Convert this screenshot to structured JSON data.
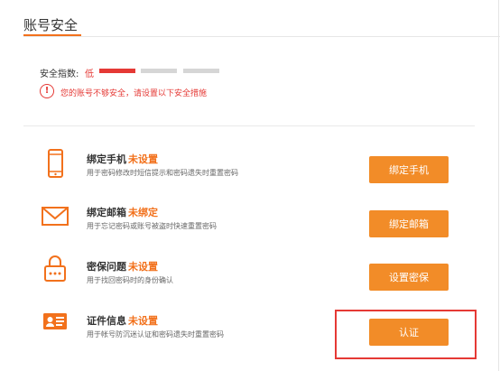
{
  "page": {
    "title": "账号安全"
  },
  "security": {
    "score_label": "安全指数:",
    "score_level": "低",
    "strength_filled_bars": 1,
    "strength_total_bars": 3,
    "warning_text": "您的账号不够安全，请设置以下安全措施",
    "warning_icon": "alert-icon",
    "colors": {
      "accent": "#f2711c",
      "danger": "#e53935",
      "button": "#f28c28",
      "bar_inactive": "#d6d6d6"
    }
  },
  "items": [
    {
      "icon": "phone-icon",
      "title": "绑定手机",
      "status": "未设置",
      "description": "用于密码修改时短信提示和密码遗失时重置密码",
      "button_label": "绑定手机"
    },
    {
      "icon": "mail-icon",
      "title": "绑定邮箱",
      "status": "未绑定",
      "description": "用于忘记密码或账号被盗时快速重置密码",
      "button_label": "绑定邮箱"
    },
    {
      "icon": "lock-icon",
      "title": "密保问题",
      "status": "未设置",
      "description": "用于找回密码时的身份确认",
      "button_label": "设置密保"
    },
    {
      "icon": "id-card-icon",
      "title": "证件信息",
      "status": "未设置",
      "description": "用于帐号防沉迷认证和密码遗失时重置密码",
      "button_label": "认证"
    }
  ]
}
